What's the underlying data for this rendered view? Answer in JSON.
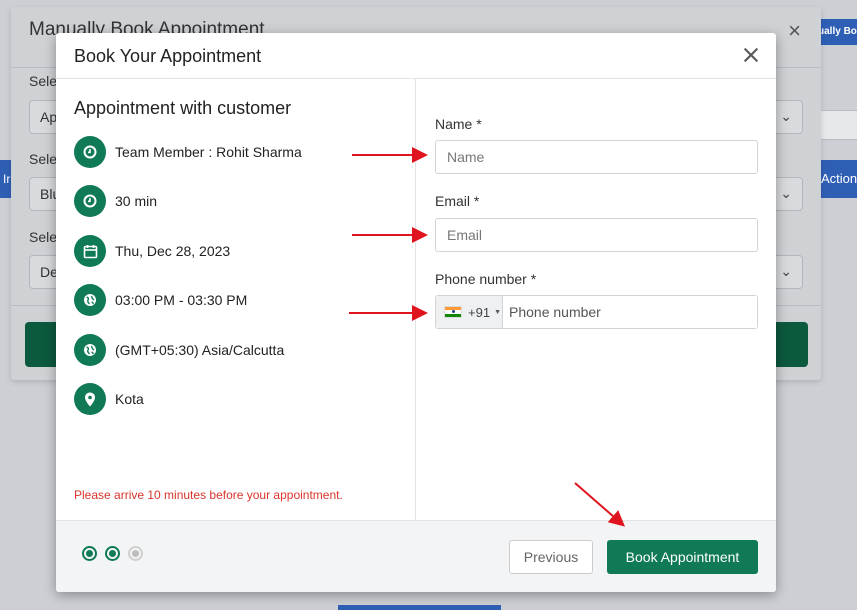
{
  "background": {
    "right_button_label": "ually Bo",
    "left_strip_label": "Ir",
    "right_action_label": "Action"
  },
  "underlying_modal": {
    "title": "Manually Book Appointment",
    "select_label_1": "Sele",
    "select_value_1": "Ap",
    "select_label_2": "Sele",
    "select_value_2": "Blu",
    "select_label_3": "Sele",
    "select_value_3": "De"
  },
  "modal": {
    "title": "Book Your Appointment",
    "close_symbol": "×"
  },
  "appointment": {
    "heading": "Appointment with customer",
    "items": [
      {
        "icon": "clock-icon",
        "text": "Team Member : Rohit Sharma"
      },
      {
        "icon": "clock-icon",
        "text": "30 min"
      },
      {
        "icon": "calendar-icon",
        "text": "Thu, Dec 28, 2023"
      },
      {
        "icon": "globe-icon",
        "text": "03:00 PM - 03:30 PM"
      },
      {
        "icon": "globe-icon",
        "text": "(GMT+05:30) Asia/Calcutta"
      },
      {
        "icon": "location-pin-icon",
        "text": "Kota"
      }
    ],
    "notice": "Please arrive 10 minutes before your appointment."
  },
  "form": {
    "name_label": "Name *",
    "name_placeholder": "Name",
    "name_value": "",
    "email_label": "Email *",
    "email_placeholder": "Email",
    "email_value": "",
    "phone_label": "Phone number *",
    "phone_country_code": "+91",
    "phone_country": "India",
    "phone_placeholder": "Phone number",
    "phone_value": ""
  },
  "footer": {
    "steps": [
      "done",
      "done",
      "todo"
    ],
    "previous_label": "Previous",
    "book_label": "Book Appointment"
  },
  "colors": {
    "accent": "#0f7a55",
    "notice": "#d9352b",
    "annotation_arrow": "#e0141e"
  }
}
